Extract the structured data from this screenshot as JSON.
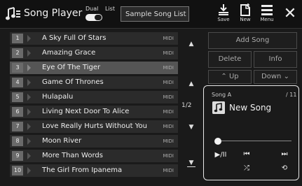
{
  "header": {
    "title": "Song Player",
    "dual_label": "Dual",
    "list_label": "List",
    "songlist_name": "Sample Song List",
    "save_label": "Save",
    "new_label": "New",
    "menu_label": "Menu",
    "close_symbol": "✕"
  },
  "songs": [
    {
      "num": "1",
      "title": "A Sky Full Of Stars",
      "type": "MIDI"
    },
    {
      "num": "2",
      "title": "Amazing Grace",
      "type": "MIDI"
    },
    {
      "num": "3",
      "title": "Eye Of The Tiger",
      "type": "MIDI"
    },
    {
      "num": "4",
      "title": "Game Of Thrones",
      "type": "MIDI"
    },
    {
      "num": "5",
      "title": "Hulapalu",
      "type": "MIDI"
    },
    {
      "num": "6",
      "title": "Living Next Door To Alice",
      "type": "MIDI"
    },
    {
      "num": "7",
      "title": "Love Really Hurts Without You",
      "type": "MIDI"
    },
    {
      "num": "8",
      "title": "Moon River",
      "type": "MIDI"
    },
    {
      "num": "9",
      "title": "More Than Words",
      "type": "MIDI"
    },
    {
      "num": "10",
      "title": "The Girl From Ipanema",
      "type": "MIDI"
    }
  ],
  "selected_index": 2,
  "scroll": {
    "page_indicator": "1/2"
  },
  "actions": {
    "add_song": "Add Song",
    "delete": "Delete",
    "info": "Info",
    "up": "Up",
    "down": "Down"
  },
  "player": {
    "song_label": "Song A",
    "count": "/ 11",
    "title": "New Song",
    "progress": 0.0,
    "play_pause_symbol": "▶/II",
    "prev_symbol": "⏮",
    "next_symbol": "⏭",
    "shuffle_symbol": "⤮",
    "repeat_symbol": "⟲"
  }
}
